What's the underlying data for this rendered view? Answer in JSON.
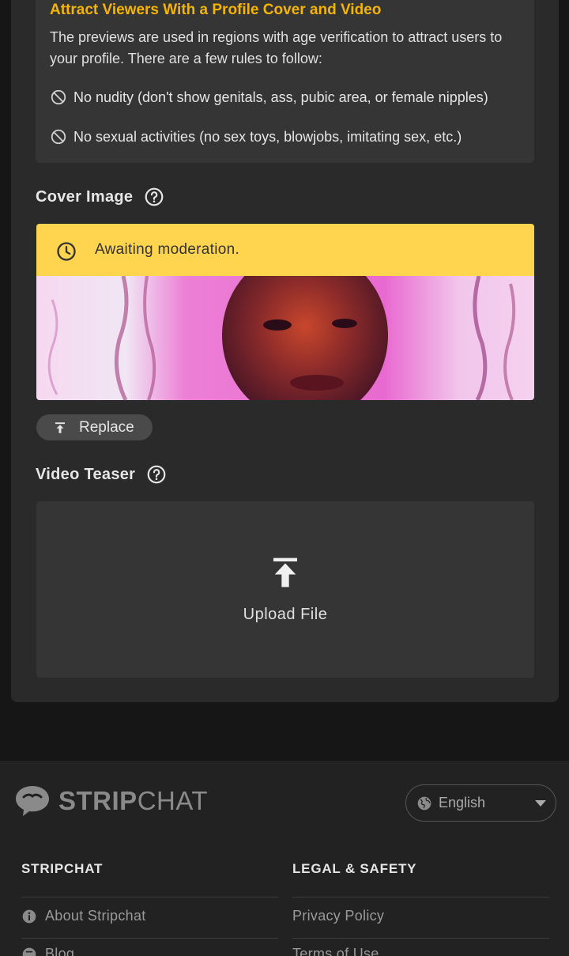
{
  "info": {
    "title": "Attract Viewers With a Profile Cover and Video",
    "description": "The previews are used in regions with age verification to attract users to your profile. There are a few rules to follow:",
    "rules": [
      "No nudity (don't show genitals, ass, pubic area, or female nipples)",
      "No sexual activities (no sex toys, blowjobs, imitating sex, etc.)"
    ]
  },
  "cover": {
    "title": "Cover Image",
    "status": "Awaiting moderation.",
    "replace_label": "Replace",
    "status_color": "#ffd54f"
  },
  "video": {
    "title": "Video Teaser",
    "upload_label": "Upload File"
  },
  "footer": {
    "logo_bold": "STRIP",
    "logo_light": "CHAT",
    "language": "English",
    "col1": {
      "heading": "STRIPCHAT",
      "links": [
        "About Stripchat",
        "Blog"
      ]
    },
    "col2": {
      "heading": "LEGAL & SAFETY",
      "links": [
        "Privacy Policy",
        "Terms of Use"
      ]
    }
  },
  "colors": {
    "accent": "#f5b400",
    "background": "#161616",
    "panel": "#2a2a2a"
  }
}
